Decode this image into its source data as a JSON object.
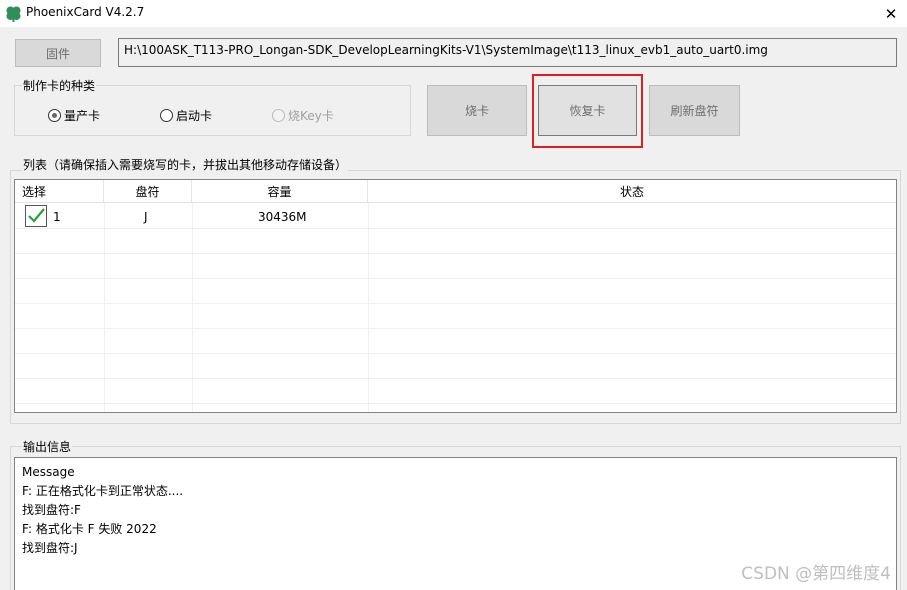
{
  "window": {
    "title": "PhoenixCard V4.2.7",
    "close_glyph": "✕"
  },
  "toolbar": {
    "firmware_button": "固件",
    "image_path": "H:\\100ASK_T113-PRO_Longan-SDK_DevelopLearningKits-V1\\SystemImage\\t113_linux_evb1_auto_uart0.img"
  },
  "card_type": {
    "group_label": "制作卡的种类",
    "options": [
      {
        "label": "量产卡",
        "checked": true,
        "disabled": false
      },
      {
        "label": "启动卡",
        "checked": false,
        "disabled": false
      },
      {
        "label": "烧Key卡",
        "checked": false,
        "disabled": true
      }
    ]
  },
  "actions": {
    "burn_button": "烧卡",
    "restore_button": "恢复卡",
    "refresh_button": "刷新盘符"
  },
  "device_list": {
    "group_label": "列表（请确保插入需要烧写的卡，并拔出其他移动存储设备）",
    "columns": [
      "选择",
      "盘符",
      "容量",
      "状态"
    ],
    "rows": [
      {
        "select": "1",
        "checked": true,
        "drive": "J",
        "capacity": "30436M",
        "status": ""
      }
    ]
  },
  "output": {
    "group_label": "输出信息",
    "lines": [
      "Message",
      "F: 正在格式化卡到正常状态....",
      "找到盘符:F",
      "F: 格式化卡 F 失败 2022",
      "找到盘符:J"
    ]
  },
  "watermark": "CSDN @第四维度4",
  "icons": {
    "app": "clover-icon",
    "checkmark": "green-check-icon"
  },
  "colors": {
    "highlight": "#e02020",
    "check_green": "#2e9e3b"
  }
}
